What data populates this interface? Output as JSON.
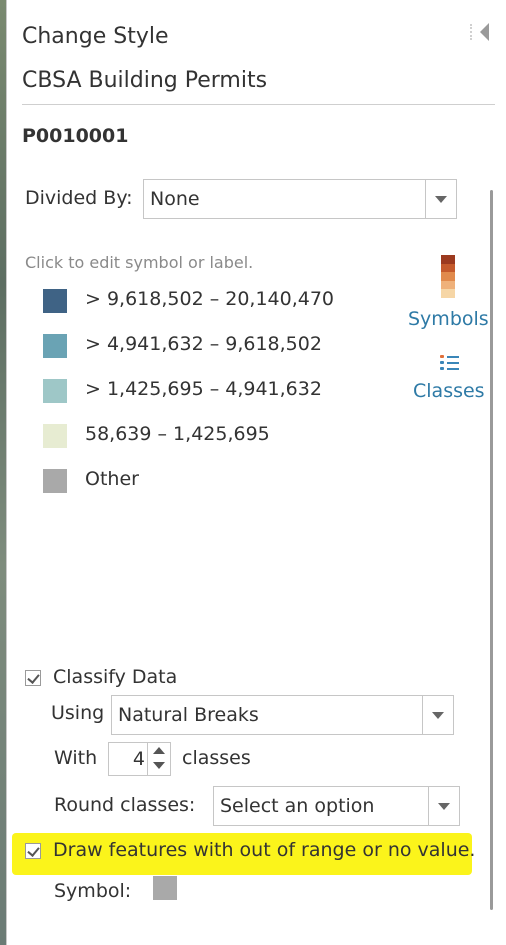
{
  "panel": {
    "title": "Change Style",
    "layer_name": "CBSA Building Permits",
    "field_name": "P0010001",
    "collapse_icon": "collapse-left-icon"
  },
  "divided_by": {
    "label": "Divided By:",
    "value": "None"
  },
  "legend": {
    "hint": "Click to edit symbol or label.",
    "classes": [
      {
        "label": "> 9,618,502 – 20,140,470",
        "color": "#3f6385"
      },
      {
        "label": "> 4,941,632 – 9,618,502",
        "color": "#6aa3b4"
      },
      {
        "label": "> 1,425,695 – 4,941,632",
        "color": "#9ec7c7"
      },
      {
        "label": "58,639 – 1,425,695",
        "color": "#e7ecd2"
      },
      {
        "label": "Other",
        "color": "#a9a9a9"
      }
    ]
  },
  "tools": {
    "symbols_label": "Symbols",
    "symbols_ramp_colors": [
      "#9c3a1f",
      "#c55a2c",
      "#e18a4c",
      "#efb17a",
      "#f6d6a6"
    ],
    "classes_label": "Classes",
    "classes_icon_colors": [
      "#e0703a",
      "#3a86b8",
      "#3a86b8"
    ]
  },
  "classify": {
    "checkbox_label": "Classify Data",
    "checked": true,
    "using_label": "Using",
    "method": "Natural Breaks",
    "with_label": "With",
    "count": "4",
    "classes_suffix": "classes",
    "round_label": "Round classes:",
    "round_placeholder": "Select an option"
  },
  "out_of_range": {
    "checkbox_label": "Draw features with out of range or no value.",
    "checked": true,
    "highlight_color": "#fbf41b",
    "symbol_label": "Symbol:",
    "symbol_color": "#a9a9a9"
  }
}
